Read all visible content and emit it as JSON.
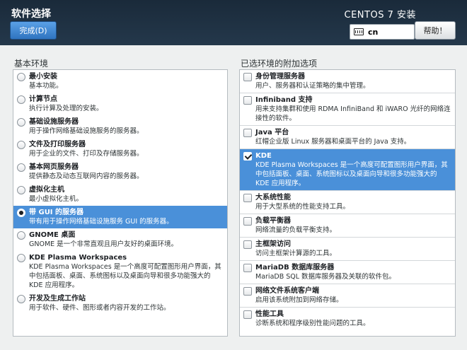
{
  "header": {
    "title": "软件选择",
    "done_label": "完成(D)",
    "product_title": "CENTOS 7 安装",
    "keyboard_layout": "cn",
    "help_label": "帮助！"
  },
  "left": {
    "label": "基本环境",
    "items": [
      {
        "title": "最小安装",
        "desc": "基本功能。",
        "selected": false
      },
      {
        "title": "计算节点",
        "desc": "执行计算及处理的安装。",
        "selected": false
      },
      {
        "title": "基础设施服务器",
        "desc": "用于操作网络基础设施服务的服务器。",
        "selected": false
      },
      {
        "title": "文件及打印服务器",
        "desc": "用于企业的文件、打印及存储服务器。",
        "selected": false
      },
      {
        "title": "基本网页服务器",
        "desc": "提供静态及动态互联网内容的服务器。",
        "selected": false
      },
      {
        "title": "虚拟化主机",
        "desc": "最小虚拟化主机。",
        "selected": false
      },
      {
        "title": "带 GUI 的服务器",
        "desc": "带有用于操作网络基础设施服务 GUI 的服务器。",
        "selected": true
      },
      {
        "title": "GNOME 桌面",
        "desc": "GNOME 是一个非常直观且用户友好的桌面环境。",
        "selected": false
      },
      {
        "title": "KDE Plasma Workspaces",
        "desc": "KDE Plasma Workspaces 是一个高度可配置图形用户界面，其中包括面板、桌面、系统图标以及桌面向导和很多功能强大的 KDE 应用程序。",
        "selected": false
      },
      {
        "title": "开发及生成工作站",
        "desc": "用于软件、硬件、图形或者内容开发的工作站。",
        "selected": false
      }
    ]
  },
  "right": {
    "label": "已选环境的附加选项",
    "items": [
      {
        "title": "身份管理服务器",
        "desc": "用户、服务器和认证策略的集中管理。",
        "checked": false,
        "highlighted": false
      },
      {
        "title": "Infiniband 支持",
        "desc": "用来支持集群和使用 RDMA InfiniBand 和 iWARO 光纤的网络连接性的软件。",
        "checked": false,
        "highlighted": false
      },
      {
        "title": "Java 平台",
        "desc": "红帽企业版 Linux 服务器和桌面平台的 Java 支持。",
        "checked": false,
        "highlighted": false
      },
      {
        "title": "KDE",
        "desc": "KDE Plasma Workspaces 是一个高度可配置图形用户界面，其中包括面板、桌面、系统图标以及桌面向导和很多功能强大的 KDE 应用程序。",
        "checked": true,
        "highlighted": true
      },
      {
        "title": "大系统性能",
        "desc": "用于大型系统的性能支持工具。",
        "checked": false,
        "highlighted": false
      },
      {
        "title": "负载平衡器",
        "desc": "网络流量的负载平衡支持。",
        "checked": false,
        "highlighted": false
      },
      {
        "title": "主框架访问",
        "desc": "访问主框架计算源的工具。",
        "checked": false,
        "highlighted": false
      },
      {
        "title": "MariaDB 数据库服务器",
        "desc": "MariaDB SQL 数据库服务器及关联的软件包。",
        "checked": false,
        "highlighted": false
      },
      {
        "title": "网络文件系统客户端",
        "desc": "启用该系统附加到网络存储。",
        "checked": false,
        "highlighted": false
      },
      {
        "title": "性能工具",
        "desc": "诊断系统和程序级别性能问题的工具。",
        "checked": false,
        "highlighted": false
      }
    ]
  }
}
